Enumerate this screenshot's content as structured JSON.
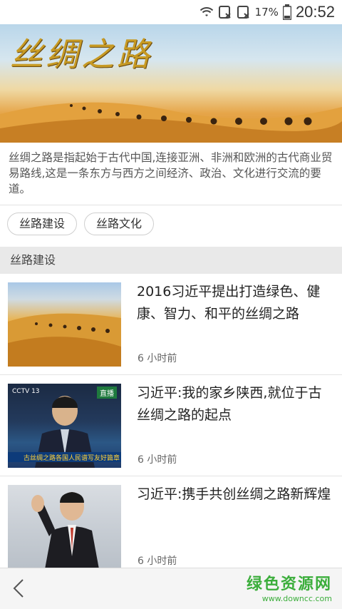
{
  "status_bar": {
    "battery_percent": "17%",
    "time": "20:52",
    "icons": [
      "wifi-icon",
      "no-sim-icon",
      "no-sim-icon",
      "battery-icon"
    ]
  },
  "banner": {
    "title_art": "丝绸之路"
  },
  "description": "丝绸之路是指起始于古代中国,连接亚洲、非洲和欧洲的古代商业贸易路线,这是一条东方与西方之间经济、政治、文化进行交流的要道。",
  "tags": [
    {
      "label": "丝路建设"
    },
    {
      "label": "丝路文化"
    }
  ],
  "section": {
    "title": "丝路建设"
  },
  "news": [
    {
      "title": "2016习近平提出打造绿色、健康、智力、和平的丝绸之路",
      "time": "6 小时前"
    },
    {
      "title": "习近平:我的家乡陕西,就位于古丝绸之路的起点",
      "time": "6 小时前"
    },
    {
      "title": "习近平:携手共创丝绸之路新辉煌",
      "time": "6 小时前"
    }
  ],
  "thumb_text": {
    "channel_logo": "CCTV 13",
    "live_badge": "直播",
    "caption": "古丝绸之路各国人民谱写友好篇章"
  },
  "bottom_bar": {
    "watermark_main": "绿色资源网",
    "watermark_sub": "www.downcc.com"
  },
  "colors": {
    "accent_green": "#3cae3c",
    "section_bg": "#e9e9e9"
  }
}
